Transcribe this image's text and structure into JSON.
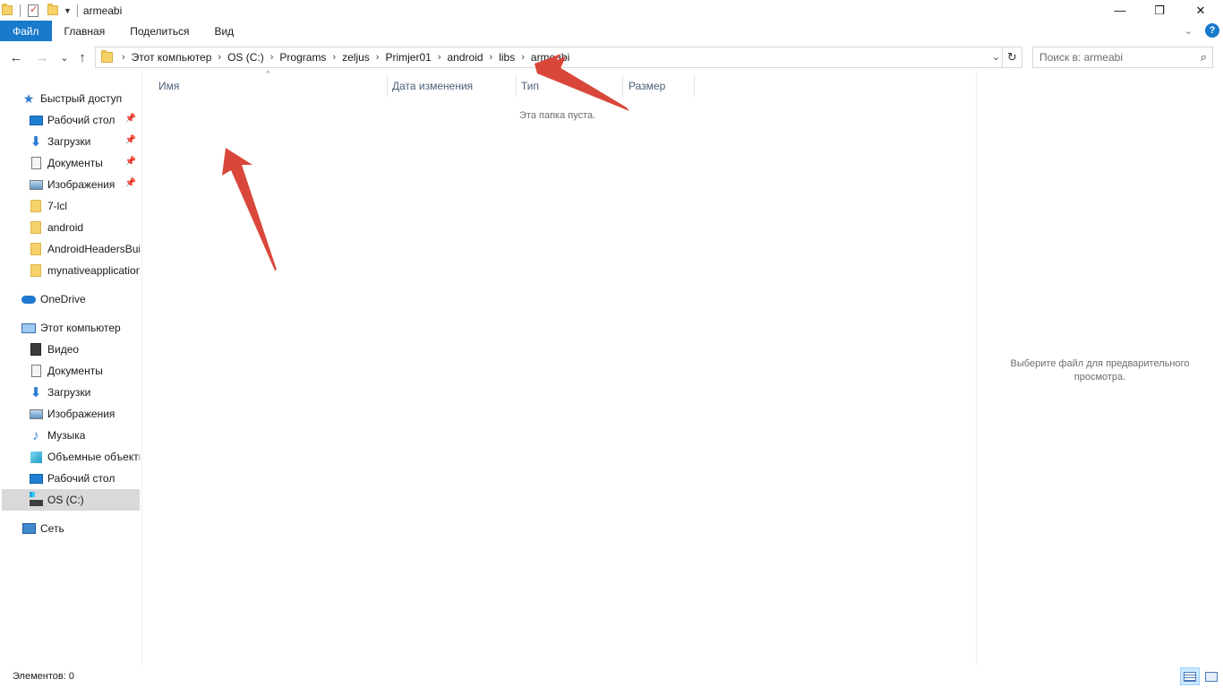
{
  "window": {
    "title": "armeabi",
    "minimize_glyph": "—",
    "restore_glyph": "❐",
    "close_glyph": "✕"
  },
  "ribbon": {
    "tabs": [
      "Файл",
      "Главная",
      "Поделиться",
      "Вид"
    ],
    "expand_glyph": "⌄",
    "help_glyph": "?"
  },
  "navigation": {
    "back_glyph": "←",
    "forward_glyph": "→",
    "recent_glyph": "⌄",
    "up_glyph": "↑"
  },
  "address_bar": {
    "breadcrumbs": [
      "Этот компьютер",
      "OS (C:)",
      "Programs",
      "zeljus",
      "Primjer01",
      "android",
      "libs",
      "armeabi"
    ],
    "separator": "›",
    "dropdown_glyph": "⌄",
    "refresh_glyph": "↻"
  },
  "search": {
    "placeholder": "Поиск в: armeabi",
    "icon_glyph": "⌕"
  },
  "nav_pane": {
    "quick_access": "Быстрый доступ",
    "quick_items": [
      {
        "label": "Рабочий стол",
        "pinned": true
      },
      {
        "label": "Загрузки",
        "pinned": true
      },
      {
        "label": "Документы",
        "pinned": true
      },
      {
        "label": "Изображения",
        "pinned": true
      },
      {
        "label": "7-lcl",
        "pinned": false
      },
      {
        "label": "android",
        "pinned": false
      },
      {
        "label": "AndroidHeadersBuil",
        "pinned": false
      },
      {
        "label": "mynativeapplication",
        "pinned": false
      }
    ],
    "onedrive": "OneDrive",
    "this_pc": "Этот компьютер",
    "pc_items": [
      "Видео",
      "Документы",
      "Загрузки",
      "Изображения",
      "Музыка",
      "Объемные объекты",
      "Рабочий стол",
      "OS (C:)"
    ],
    "selected": "OS (C:)",
    "network": "Сеть"
  },
  "file_list": {
    "columns": [
      "Имя",
      "Дата изменения",
      "Тип",
      "Размер"
    ],
    "sort_glyph": "^",
    "sorted_column": "Имя",
    "empty_message": "Эта папка пуста."
  },
  "preview_pane": {
    "message": "Выберите файл для предварительного просмотра."
  },
  "status_bar": {
    "items_text": "Элементов: 0",
    "active_view": "details"
  },
  "colors": {
    "file_tab": "#1979ca",
    "selection": "#d9d9d9",
    "annotation_arrow": "#d9473a"
  }
}
